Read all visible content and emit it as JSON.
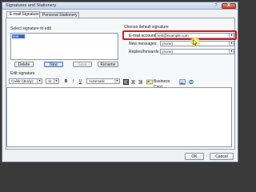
{
  "window": {
    "title": "Signatures and Stationery",
    "help_label": "?",
    "close_label": "X"
  },
  "tabs": [
    {
      "label": "E-mail Signature",
      "active": true
    },
    {
      "label": "Personal Stationery",
      "active": false
    }
  ],
  "select_signature": {
    "label": "Select signature to edit",
    "items": [
      "test"
    ],
    "selected": "test"
  },
  "signature_buttons": {
    "delete": "Delete",
    "new": "New",
    "save": "Save",
    "rename": "Rename"
  },
  "default_signature": {
    "heading": "Choose default signature",
    "email_account_label": "E-mail account:",
    "email_account_value": "test@example.com",
    "new_messages_label": "New messages:",
    "new_messages_value": "(none)",
    "replies_label": "Replies/forwards:",
    "replies_value": "(none)"
  },
  "edit_signature": {
    "label": "Edit signature",
    "font": "Calibri (Body)",
    "size": "11",
    "bold": "B",
    "italic": "I",
    "underline": "U",
    "color": "Automatic",
    "business_card": "Business Card"
  },
  "dialog_buttons": {
    "ok": "OK",
    "cancel": "Cancel"
  },
  "colors": {
    "highlight": "#d8181c",
    "selection": "#3468c4"
  }
}
